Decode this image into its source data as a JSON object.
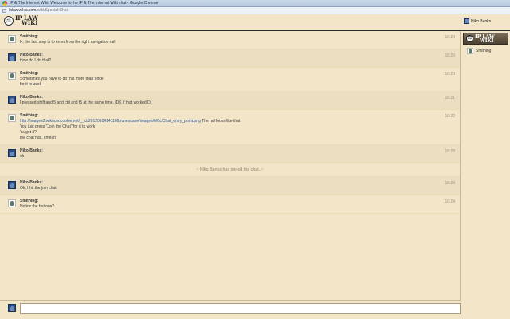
{
  "browser": {
    "title": "IP & The Internet Wiki: Welcome to the IP & The Internet Wiki chat - Google Chrome",
    "url_host": "iplaw.wikia.com",
    "url_path": "/wiki/Special:Chat"
  },
  "header": {
    "logo_line1": "IP LAW",
    "logo_line2": "WIKI",
    "current_user": "Niko Banks"
  },
  "messages": [
    {
      "author": "Smithing:",
      "avatar": "smithing",
      "time": "10:20",
      "lines": [
        "K, the last step is to enter from the right navigation rail"
      ]
    },
    {
      "author": "Niko Banks:",
      "avatar": "niko",
      "time": "10:20",
      "lines": [
        "How do I do that?"
      ]
    },
    {
      "author": "Smithing:",
      "avatar": "smithing",
      "time": "10:20",
      "lines": [
        "Sometimes you have to do this more than once",
        "for it to work"
      ]
    },
    {
      "author": "Niko Banks:",
      "avatar": "niko",
      "time": "10:21",
      "lines": [
        "I pressed shift and 5 and ctrl and f5 at the same time. IDK if that worked D:"
      ]
    },
    {
      "author": "Smithing:",
      "avatar": "smithing",
      "time": "10:22",
      "link": "http://images2.wikia.nocookie.net/__cb20120104141109/runescape/images/6/6c/Chat_entry_point.png",
      "link_suffix": " The rail looks like that",
      "lines": [
        "You just press \"Join the Chat\" for it to work",
        "Ya got it?",
        "the chat has, i mean"
      ]
    },
    {
      "author": "Niko Banks:",
      "avatar": "niko",
      "time": "10:23",
      "lines": [
        "ok"
      ]
    },
    {
      "inline_alert": "~ Niko Banks has joined the chat. ~"
    },
    {
      "author": "Niko Banks:",
      "avatar": "niko",
      "time": "10:24",
      "lines": [
        "Ok, I hit the join chat"
      ]
    },
    {
      "author": "Smithing:",
      "avatar": "smithing",
      "time": "10:24",
      "lines": [
        "Notice the buttons?"
      ]
    }
  ],
  "rail": {
    "room_logo_line1": "IP LAW",
    "room_logo_line2": "WIKI",
    "users": [
      "Smithing"
    ]
  },
  "icons": {
    "logo": "scales-icon",
    "avatar_smithing": "user-avatar-icon",
    "avatar_niko": "user-avatar-icon"
  }
}
